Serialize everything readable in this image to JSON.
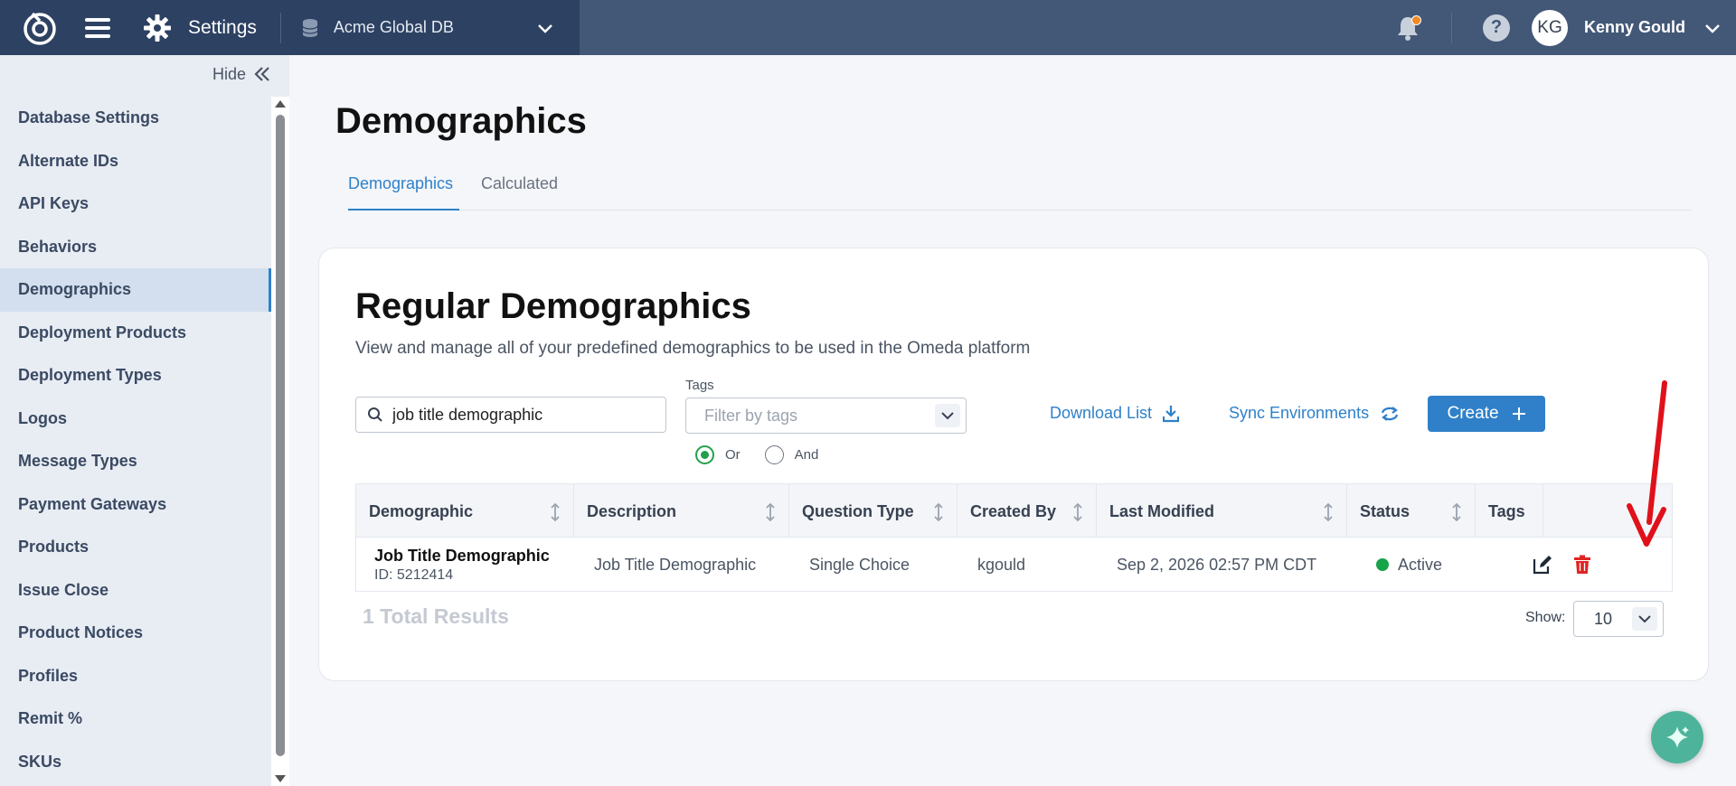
{
  "topbar": {
    "app_title": "Settings",
    "database": "Acme Global DB",
    "user_initials": "KG",
    "user_name": "Kenny Gould",
    "help_label": "?"
  },
  "sidebar": {
    "hide_label": "Hide",
    "items": [
      {
        "label": "Database Settings"
      },
      {
        "label": "Alternate IDs"
      },
      {
        "label": "API Keys"
      },
      {
        "label": "Behaviors"
      },
      {
        "label": "Demographics",
        "active": true
      },
      {
        "label": "Deployment Products"
      },
      {
        "label": "Deployment Types"
      },
      {
        "label": "Logos"
      },
      {
        "label": "Message Types"
      },
      {
        "label": "Payment Gateways"
      },
      {
        "label": "Products"
      },
      {
        "label": "Issue Close"
      },
      {
        "label": "Product Notices"
      },
      {
        "label": "Profiles"
      },
      {
        "label": "Remit %"
      },
      {
        "label": "SKUs"
      }
    ]
  },
  "main": {
    "page_title": "Demographics",
    "tabs": [
      {
        "label": "Demographics",
        "active": true
      },
      {
        "label": "Calculated"
      }
    ]
  },
  "card": {
    "title": "Regular Demographics",
    "subtitle": "View and manage all of your predefined demographics to be used in the Omeda platform",
    "search_value": "job title demographic",
    "tags_label": "Tags",
    "tags_placeholder": "Filter by tags",
    "radio_or": "Or",
    "radio_and": "And",
    "download_label": "Download List",
    "sync_label": "Sync Environments",
    "create_label": "Create",
    "columns": [
      "Demographic",
      "Description",
      "Question Type",
      "Created By",
      "Last Modified",
      "Status",
      "Tags"
    ],
    "rows": [
      {
        "name": "Job Title Demographic",
        "id": "ID: 5212414",
        "description": "Job Title Demographic",
        "question_type": "Single Choice",
        "created_by": "kgould",
        "last_modified": "Sep 2, 2026 02:57 PM CDT",
        "status": "Active"
      }
    ],
    "total_results": "1 Total Results",
    "show_label": "Show:",
    "show_value": "10"
  },
  "colors": {
    "accent": "#2f80c9",
    "active_status": "#16a34a",
    "delete": "#e02424",
    "annotation_arrow": "#e0111a"
  },
  "icons": [
    "omeda-logo-icon",
    "hamburger-icon",
    "gear-icon",
    "database-icon",
    "chevron-down-icon",
    "bell-icon",
    "help-icon",
    "double-chevron-left-icon",
    "search-icon",
    "download-icon",
    "sync-icon",
    "plus-icon",
    "sort-icon",
    "edit-icon",
    "trash-icon",
    "sparkle-icon"
  ]
}
